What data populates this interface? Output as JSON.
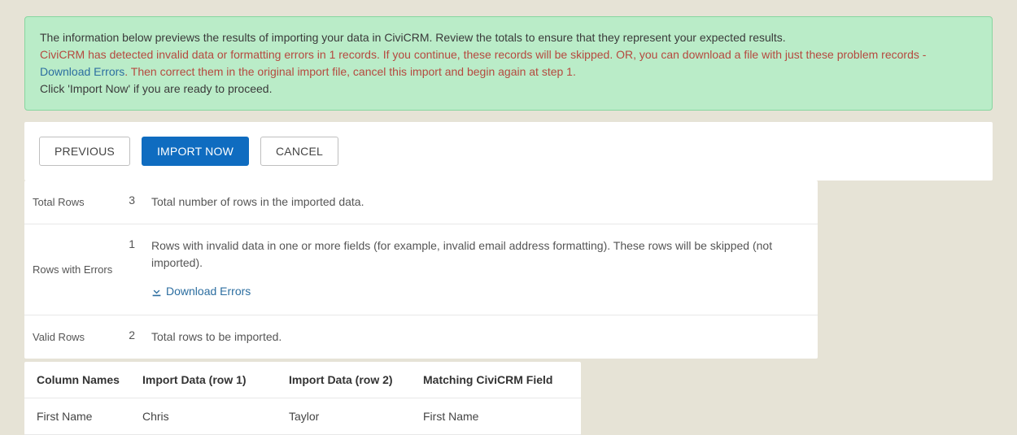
{
  "alert": {
    "line1": "The information below previews the results of importing your data in CiviCRM. Review the totals to ensure that they represent your expected results.",
    "err1": "CiviCRM has detected invalid data or formatting errors in 1 records. If you continue, these records will be skipped. OR, you can download a file with just these problem records - ",
    "download_label": "Download Errors",
    "err2": ". Then correct them in the original import file, cancel this import and begin again at step 1.",
    "line3": "Click 'Import Now' if you are ready to proceed."
  },
  "buttons": {
    "previous": "Previous",
    "import_now": "Import Now",
    "cancel": "Cancel"
  },
  "stats": {
    "total_label": "Total Rows",
    "total_count": "3",
    "total_desc": "Total number of rows in the imported data.",
    "errors_label": "Rows with Errors",
    "errors_count": "1",
    "errors_desc": "Rows with invalid data in one or more fields (for example, invalid email address formatting). These rows will be skipped (not imported).",
    "errors_download": "Download Errors",
    "valid_label": "Valid Rows",
    "valid_count": "2",
    "valid_desc": "Total rows to be imported."
  },
  "preview": {
    "headers": {
      "col1": "Column Names",
      "col2": "Import Data (row 1)",
      "col3": "Import Data (row 2)",
      "col4": "Matching CiviCRM Field"
    },
    "row1": {
      "c1": "First Name",
      "c2": "Chris",
      "c3": "Taylor",
      "c4": "First Name"
    }
  }
}
